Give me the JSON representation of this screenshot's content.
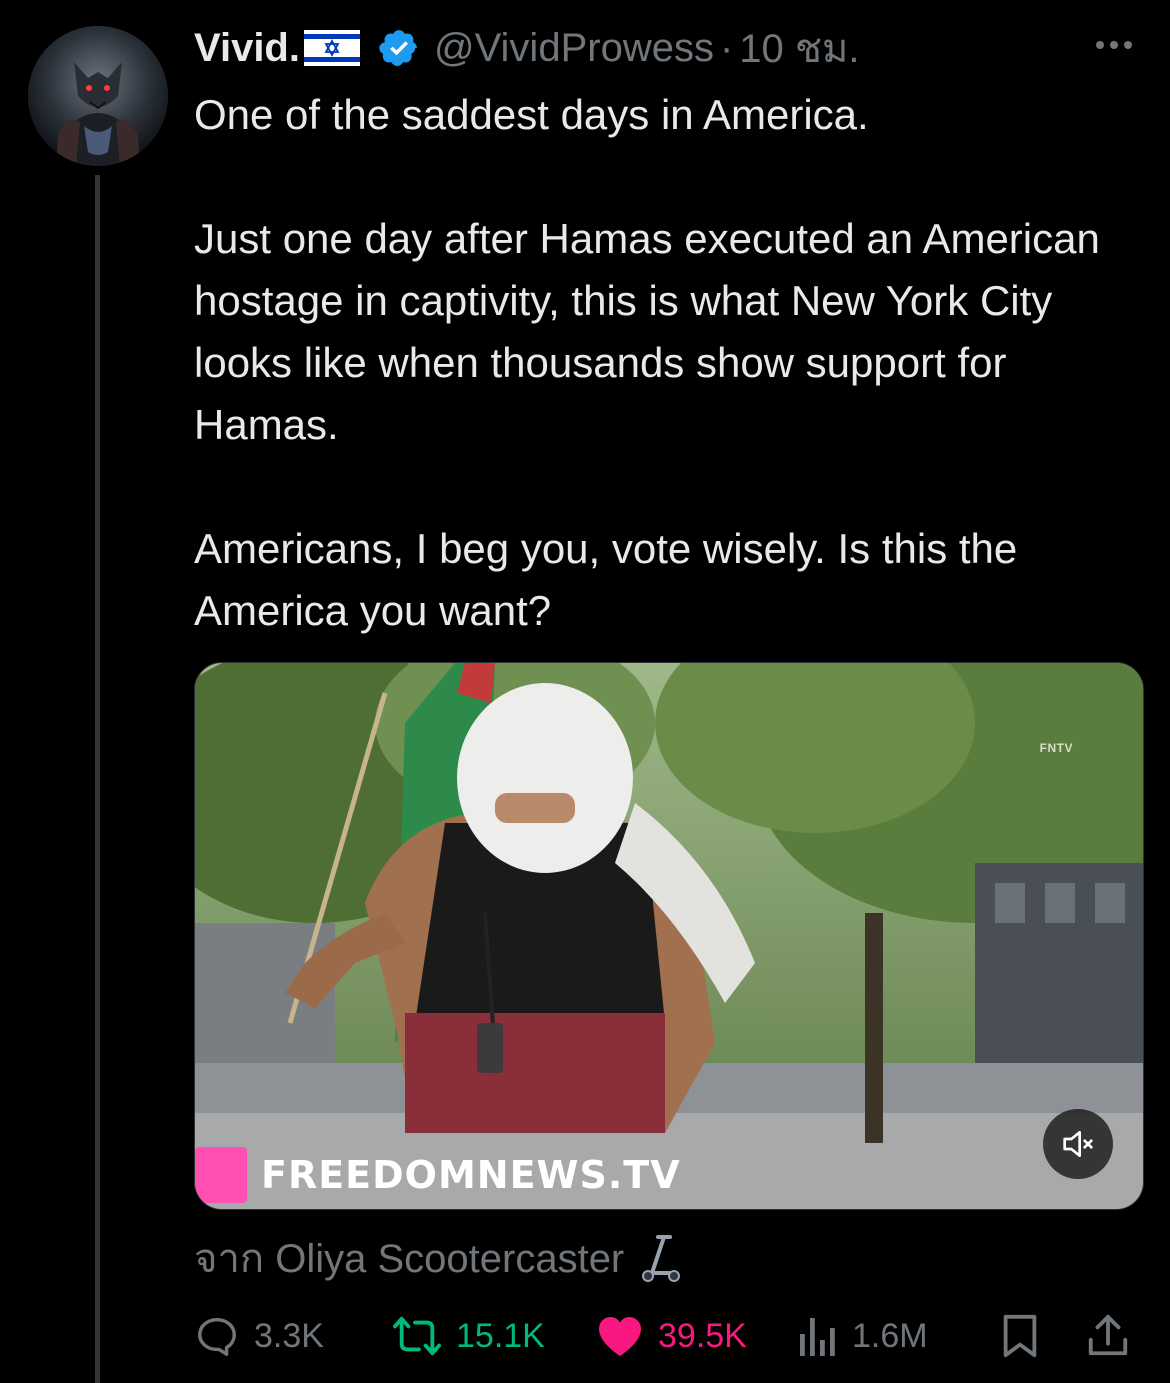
{
  "author": {
    "display_name": "Vivid.",
    "flag": "israel-flag-icon",
    "verified": true,
    "handle": "@VividProwess",
    "separator": "·",
    "time": "10 ชม."
  },
  "tweet": {
    "text": "One of the saddest days in America.\n\nJust one day after Hamas executed an American hostage in captivity, this is what New York City looks like when thousands show support for Hamas.\n\nAmericans, I beg you, vote wisely. Is this the America you want?"
  },
  "media": {
    "type": "video",
    "watermark": "FNTV",
    "brand_text": "FREEDOMNEWS.TV",
    "muted": true
  },
  "attribution": {
    "text": "จาก Oliya Scootercaster",
    "emoji": "scooter-icon"
  },
  "actions": {
    "replies": "3.3K",
    "retweets": "15.1K",
    "likes": "39.5K",
    "views": "1.6M"
  },
  "colors": {
    "background": "#000000",
    "text": "#e7e9ea",
    "muted": "#71767b",
    "verified": "#1d9bf0",
    "retweet": "#00ba7c",
    "like": "#f91880",
    "brand_pink": "#ff4fb3"
  }
}
